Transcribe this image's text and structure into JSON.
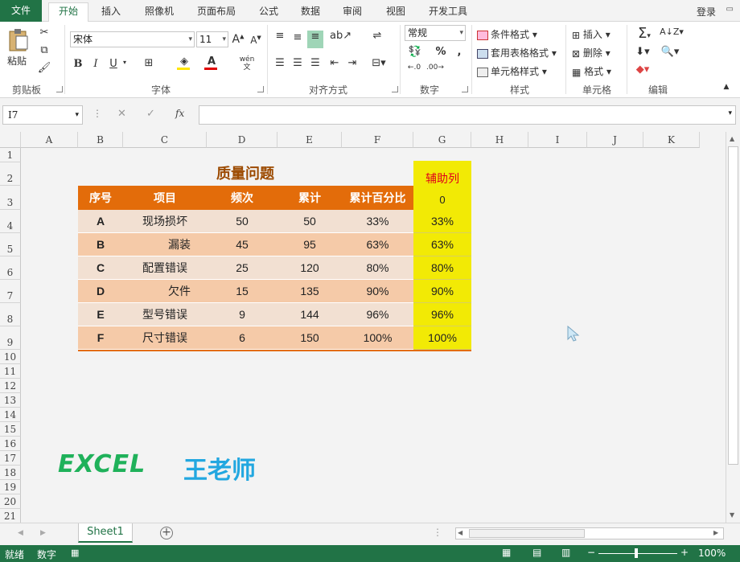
{
  "tabs": {
    "file": "文件",
    "home": "开始",
    "insert": "插入",
    "camera": "照像机",
    "layout": "页面布局",
    "formulas": "公式",
    "data": "数据",
    "review": "审阅",
    "view": "视图",
    "developer": "开发工具"
  },
  "login": "登录",
  "ribbon": {
    "paste": "粘贴",
    "clipboard_label": "剪贴板",
    "font_name": "宋体",
    "font_size": "11",
    "font_label": "字体",
    "align_label": "对齐方式",
    "number_format": "常规",
    "number_label": "数字",
    "cond_format": "条件格式",
    "table_format": "套用表格格式",
    "cell_style": "单元格样式",
    "styles_label": "样式",
    "insert": "插入",
    "delete": "删除",
    "format": "格式",
    "cells_label": "单元格",
    "edit_label": "编辑"
  },
  "namebox": "I7",
  "fx": "fx",
  "columns": [
    "A",
    "B",
    "C",
    "D",
    "E",
    "F",
    "G",
    "H",
    "I",
    "J",
    "K"
  ],
  "rows": [
    "1",
    "2",
    "3",
    "4",
    "5",
    "6",
    "7",
    "8",
    "9",
    "10",
    "11",
    "12",
    "13",
    "14",
    "15",
    "16",
    "17",
    "18",
    "19",
    "20",
    "21"
  ],
  "table": {
    "title": "质量问题",
    "helper_header": "辅助列",
    "helper_zero": "0",
    "headers": [
      "序号",
      "项目",
      "频次",
      "累计",
      "累计百分比"
    ],
    "rows": [
      {
        "id": "A",
        "item": "现场损坏",
        "freq": "50",
        "cum": "50",
        "pct": "33%",
        "helper": "33%"
      },
      {
        "id": "B",
        "item": "漏装",
        "freq": "45",
        "cum": "95",
        "pct": "63%",
        "helper": "63%"
      },
      {
        "id": "C",
        "item": "配置错误",
        "freq": "25",
        "cum": "120",
        "pct": "80%",
        "helper": "80%"
      },
      {
        "id": "D",
        "item": "欠件",
        "freq": "15",
        "cum": "135",
        "pct": "90%",
        "helper": "90%"
      },
      {
        "id": "E",
        "item": "型号错误",
        "freq": "9",
        "cum": "144",
        "pct": "96%",
        "helper": "96%"
      },
      {
        "id": "F",
        "item": "尺寸错误",
        "freq": "6",
        "cum": "150",
        "pct": "100%",
        "helper": "100%"
      }
    ]
  },
  "watermark": {
    "excel": "EXCEL",
    "teacher": "王老师"
  },
  "sheet_tab": "Sheet1",
  "status": {
    "ready": "就绪",
    "numeric": "数字",
    "zoom": "100%"
  },
  "colors": {
    "excel_green": "#217346",
    "header_orange": "#e36c0a",
    "row_light": "#f2e0d2",
    "row_dark": "#f5caa8",
    "helper_yellow": "#f2ea05",
    "title_brown": "#9c4a00",
    "helper_red": "#e0001a"
  }
}
